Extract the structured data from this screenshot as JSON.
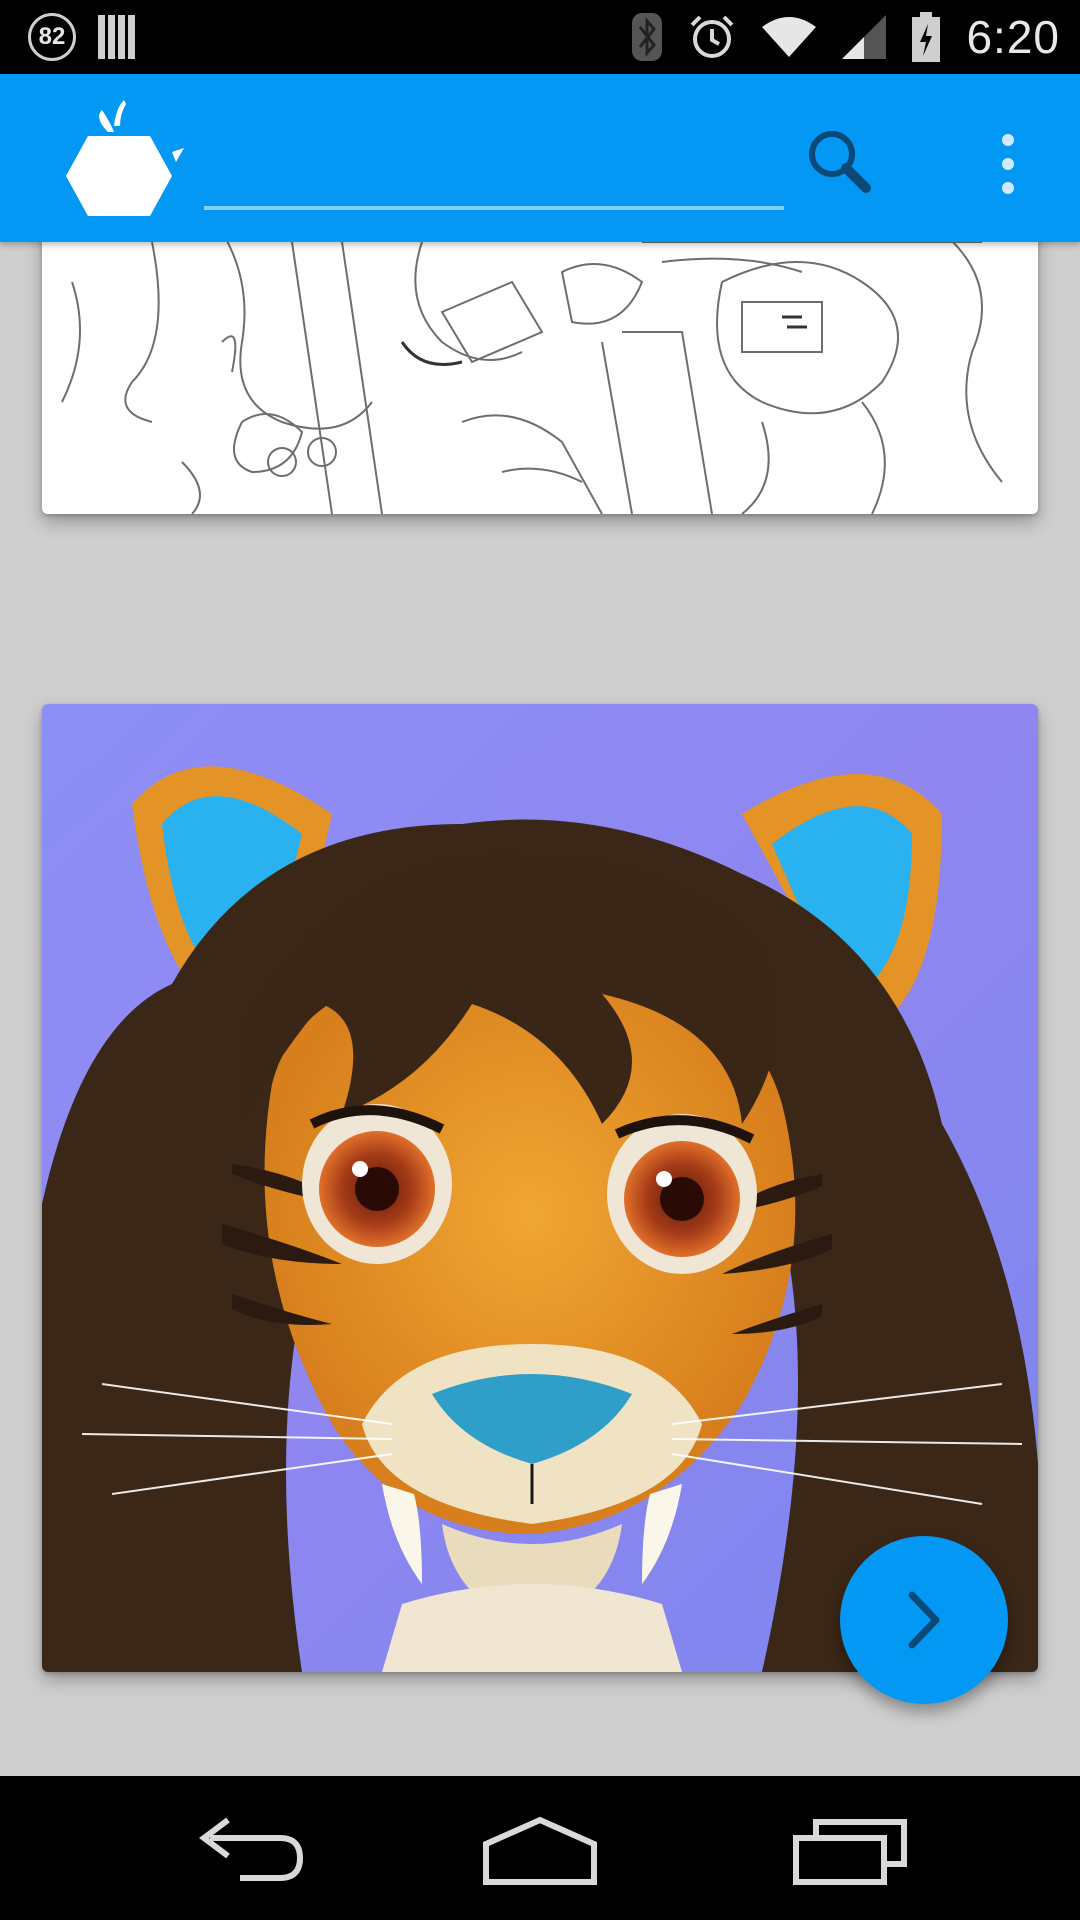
{
  "status_bar": {
    "notification_badge": "82",
    "time": "6:20",
    "icons": [
      "notification-count-icon",
      "barcode-icon",
      "bluetooth-icon",
      "alarm-icon",
      "wifi-icon",
      "signal-icon",
      "battery-charging-icon"
    ]
  },
  "app_bar": {
    "logo": "app-logo-icon",
    "search": {
      "value": "",
      "placeholder": ""
    },
    "actions": [
      "search-icon",
      "overflow-menu-icon"
    ]
  },
  "feed": {
    "items": [
      {
        "kind": "sketch-artwork"
      },
      {
        "kind": "tiger-portrait-artwork"
      }
    ]
  },
  "fab": {
    "icon": "chevron-right-icon"
  },
  "nav_bar": {
    "buttons": [
      "back-icon",
      "home-icon",
      "recents-icon"
    ]
  },
  "colors": {
    "accent": "#0398f4",
    "background": "#cfcfcf",
    "search_underline": "#85d0f6"
  }
}
